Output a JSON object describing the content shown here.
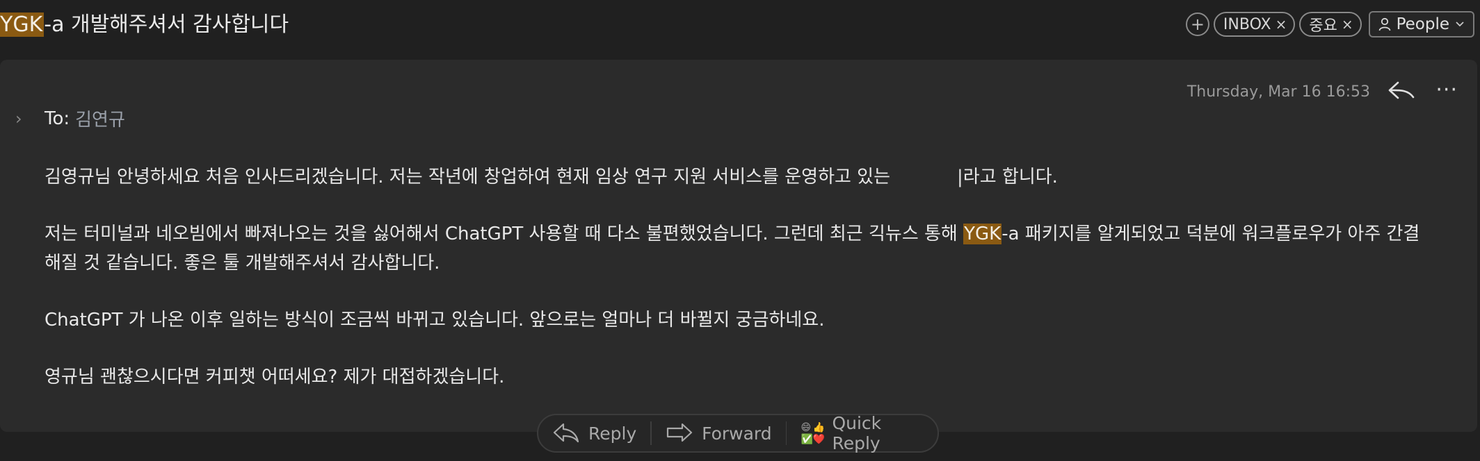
{
  "header": {
    "subject_highlight": "YGK",
    "subject_rest": "-a 개발해주셔서 감사합니다",
    "add_tag_label": "+",
    "tags": [
      {
        "label": "INBOX",
        "remove": "×"
      },
      {
        "label": "중요",
        "remove": "×"
      }
    ],
    "people_label": "People"
  },
  "message": {
    "date": "Thursday, Mar 16 16:53",
    "more_label": "···",
    "to_label": "To:",
    "to_name": "김연규",
    "expand_label": "›",
    "p1_before": "김영규님 안녕하세요 처음 인사드리겠습니다. 저는 작년에 창업하여 현재 임상 연구 지원 서비스를 운영하고 있는",
    "p1_after": "|라고 합니다.",
    "p2_before": "저는 터미널과 네오빔에서 빠져나오는 것을 싫어해서 ChatGPT 사용할 때 다소 불편했었습니다. 그런데 최근 긱뉴스 통해 ",
    "p2_highlight": "YGK",
    "p2_after": "-a 패키지를 알게되었고 덕분에 워크플로우가 아주 간결해질 것 같습니다. 좋은 툴 개발해주셔서 감사합니다.",
    "p3": "ChatGPT 가 나온 이후 일하는 방식이 조금씩 바뀌고 있습니다. 앞으로는 얼마나 더 바뀔지 궁금하네요.",
    "p4": "영규님 괜찮으시다면 커피챗 어떠세요? 제가 대접하겠습니다."
  },
  "actions": {
    "reply": "Reply",
    "forward": "Forward",
    "quick_reply": "Quick Reply",
    "quick_reply_emojis": [
      "😄",
      "👍",
      "✅",
      "❤️"
    ]
  },
  "colors": {
    "highlight": "#8a5a12",
    "background": "#202020",
    "card": "#2b2b2b"
  }
}
